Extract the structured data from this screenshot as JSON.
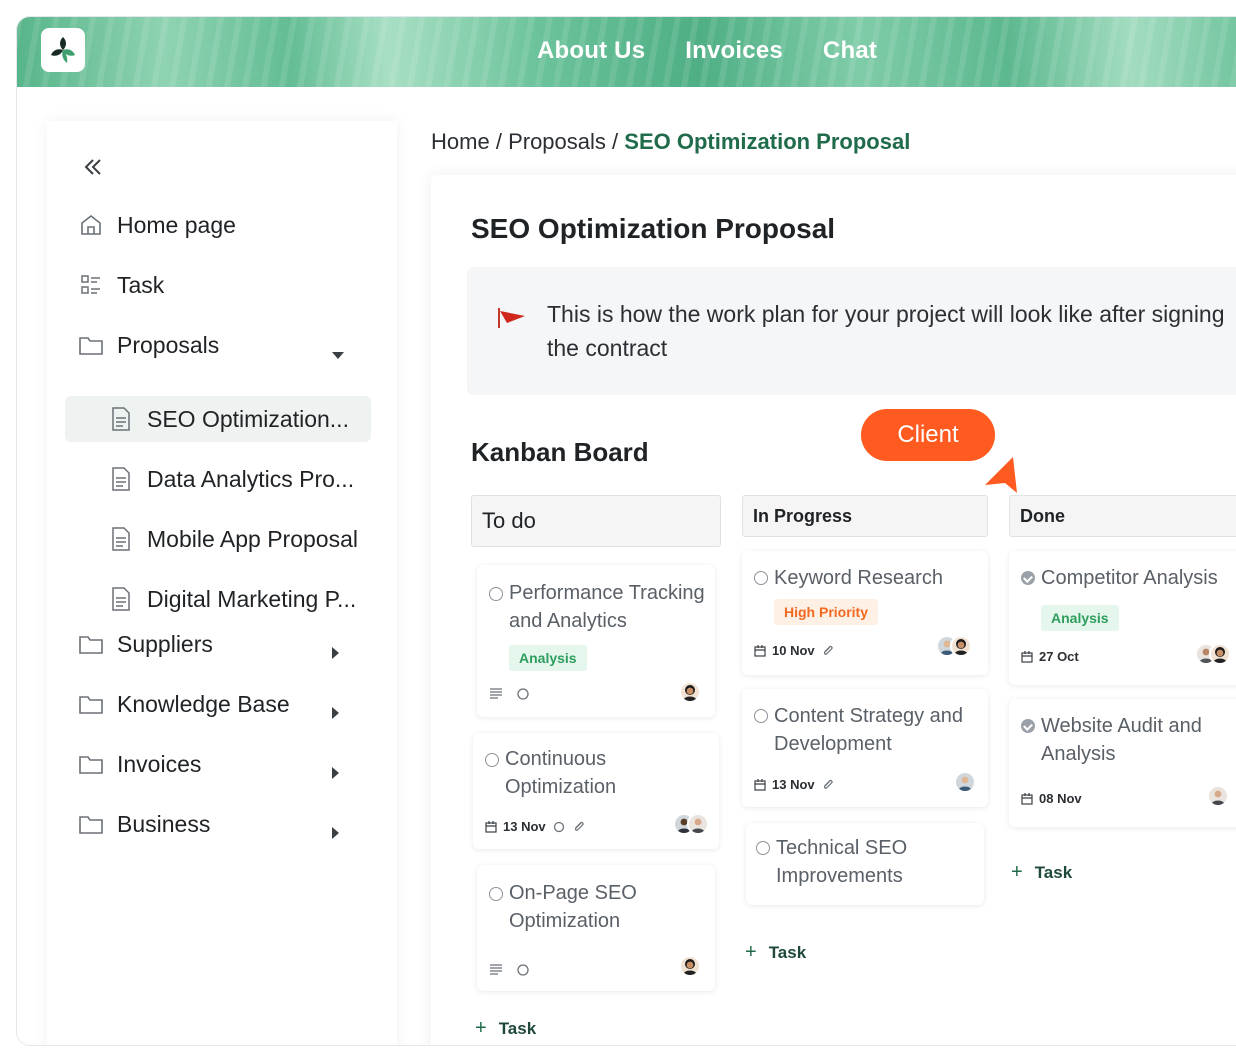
{
  "header": {
    "nav": [
      "About Us",
      "Invoices",
      "Chat"
    ]
  },
  "sidebar": {
    "items": [
      {
        "label": "Home page",
        "icon": "home-icon"
      },
      {
        "label": "Task",
        "icon": "task-list-icon"
      },
      {
        "label": "Proposals",
        "icon": "folder-icon",
        "expanded": true
      },
      {
        "label": "Suppliers",
        "icon": "folder-icon",
        "expanded": false
      },
      {
        "label": "Knowledge Base",
        "icon": "folder-icon",
        "expanded": false
      },
      {
        "label": "Invoices",
        "icon": "folder-icon",
        "expanded": false
      },
      {
        "label": "Business",
        "icon": "folder-icon",
        "expanded": false
      }
    ],
    "proposals": [
      {
        "label": "SEO Optimization...",
        "active": true
      },
      {
        "label": "Data Analytics Pro...",
        "active": false
      },
      {
        "label": "Mobile App Proposal",
        "active": false
      },
      {
        "label": "Digital Marketing P...",
        "active": false
      }
    ]
  },
  "breadcrumb": {
    "home": "Home",
    "sep": "/",
    "section": "Proposals",
    "current": "SEO Optimization Proposal"
  },
  "main": {
    "title": "SEO Optimization Proposal",
    "notice": "This is how the work plan for your project will look like after signing the contract",
    "kanban_title": "Kanban Board",
    "client_badge": "Client",
    "add_task_label": "Task"
  },
  "columns": [
    {
      "name": "To do",
      "cards": [
        {
          "title": "Performance Tracking and Analytics",
          "tag": "Analysis",
          "date": "",
          "avatars": 1
        },
        {
          "title": "Continuous Optimization",
          "tag": "",
          "date": "13 Nov",
          "avatars": 2
        },
        {
          "title": "On-Page SEO Optimization",
          "tag": "",
          "date": "",
          "avatars": 1
        }
      ]
    },
    {
      "name": "In Progress",
      "cards": [
        {
          "title": "Keyword Research",
          "tag": "High Priority",
          "date": "10 Nov",
          "avatars": 2
        },
        {
          "title": "Content Strategy and Development",
          "tag": "",
          "date": "13 Nov",
          "avatars": 1
        },
        {
          "title": "Technical SEO Improvements",
          "tag": "",
          "date": "",
          "avatars": 0
        }
      ]
    },
    {
      "name": "Done",
      "cards": [
        {
          "title": "Competitor Analysis",
          "tag": "Analysis",
          "date": "27 Oct",
          "avatars": 2
        },
        {
          "title": "Website Audit and Analysis",
          "tag": "",
          "date": "08 Nov",
          "avatars": 1
        }
      ]
    }
  ],
  "colors": {
    "accent_green": "#1f6b4a",
    "client_orange": "#ff5a1f",
    "tag_green": "#2e9e5f",
    "tag_orange": "#f26a1f"
  }
}
